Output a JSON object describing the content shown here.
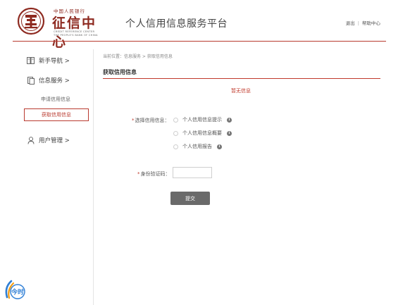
{
  "header": {
    "logo_small_text": "中国人民银行",
    "logo_main_text": "征信中心",
    "logo_en_line1": "CREDIT REFERENCE CENTER",
    "logo_en_line2": "THE PEOPLE'S BANK OF CHINA",
    "platform_title": "个人信用信息服务平台",
    "logout_label": "退出",
    "separator": "|",
    "help_label": "帮助中心",
    "accent_color": "#b93a2f"
  },
  "sidebar": {
    "guide_label": "新手导航 >",
    "service_label": "信息服务 >",
    "sub_items": [
      {
        "label": "申请信用信息",
        "active": false
      },
      {
        "label": "获取信用信息",
        "active": true
      }
    ],
    "user_label": "用户管理 >"
  },
  "main": {
    "breadcrumb": "当前位置：信息服务 > 获取信用信息",
    "section_title": "获取信用信息",
    "notice": "暂无信息",
    "credit_type_label": "选择信用信息：",
    "required_mark": "*",
    "options": [
      {
        "label": "个人信用信息提示"
      },
      {
        "label": "个人信用信息概要"
      },
      {
        "label": "个人信用报告"
      }
    ],
    "info_glyph": "i",
    "id_code_label": "身份验证码：",
    "id_code_value": "",
    "submit_label": "提交"
  },
  "watermark": {
    "icon": "jinri-logo-icon",
    "text": "今时"
  }
}
